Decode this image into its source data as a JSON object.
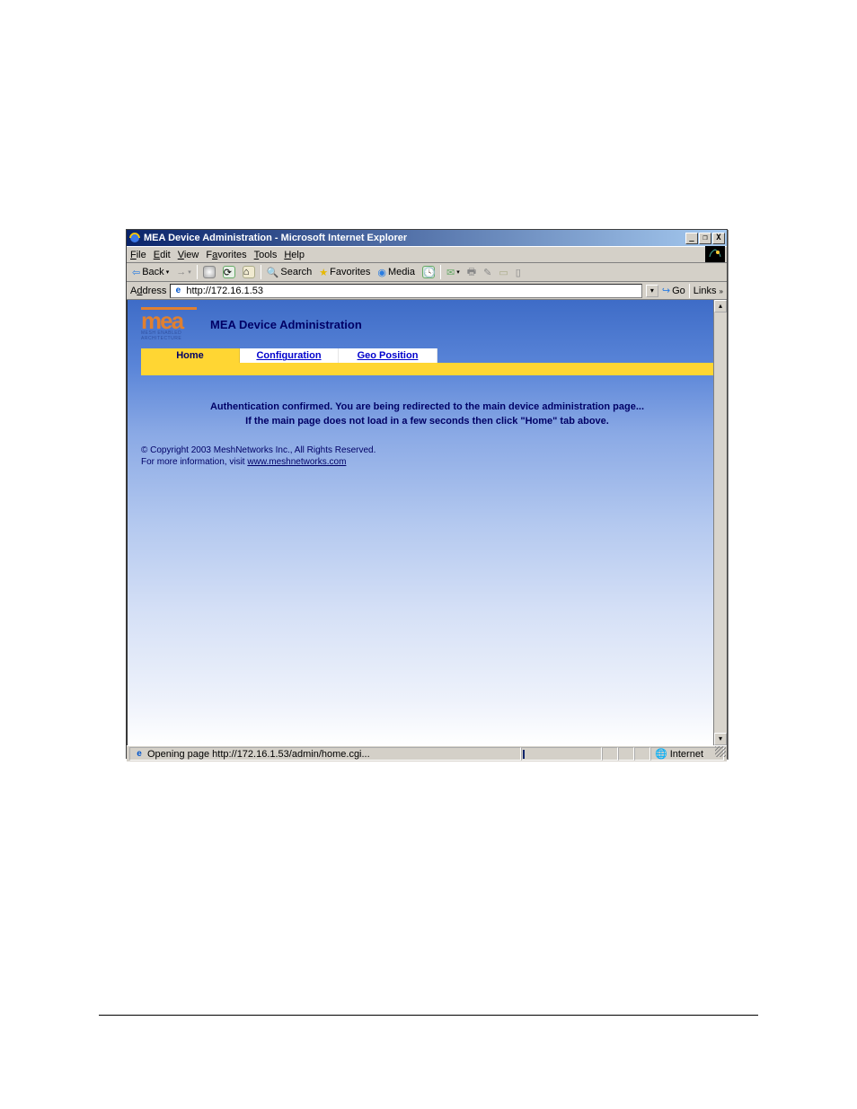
{
  "window": {
    "title": "MEA Device Administration - Microsoft Internet Explorer",
    "min": "_",
    "restore": "❐",
    "close": "X"
  },
  "menubar": [
    "File",
    "Edit",
    "View",
    "Favorites",
    "Tools",
    "Help"
  ],
  "toolbar": {
    "back": "Back",
    "search": "Search",
    "favorites": "Favorites",
    "media": "Media"
  },
  "addressbar": {
    "label": "Address",
    "url": "http://172.16.1.53",
    "go": "Go",
    "links": "Links"
  },
  "page": {
    "logo_main": "mea",
    "logo_sub1": "MESH ENABLED",
    "logo_sub2": "ARCHITECTURE",
    "title": "MEA Device Administration",
    "tabs": [
      {
        "label": "Home",
        "active": true
      },
      {
        "label": "Configuration",
        "active": false
      },
      {
        "label": "Geo Position",
        "active": false
      }
    ],
    "message_line1": "Authentication confirmed. You are being redirected to the main device administration page...",
    "message_line2": "If the main page does not load in a few seconds then click \"Home\" tab above.",
    "copyright": "© Copyright 2003 MeshNetworks Inc., All Rights Reserved.",
    "moreinfo_prefix": "For more information, visit ",
    "moreinfo_link": "www.meshnetworks.com"
  },
  "statusbar": {
    "text": "Opening page http://172.16.1.53/admin/home.cgi...",
    "zone": "Internet"
  }
}
